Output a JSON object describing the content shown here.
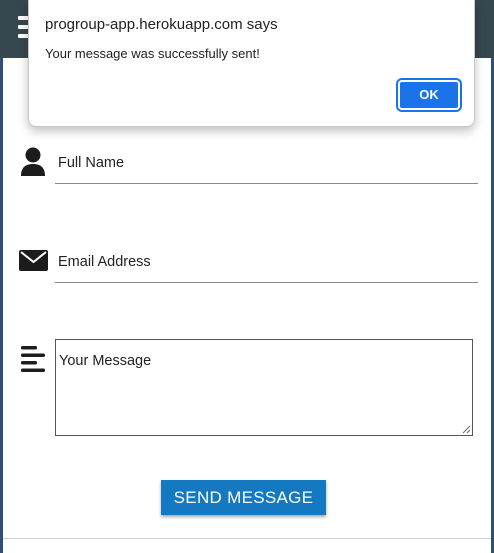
{
  "dialog": {
    "title": "progroup-app.herokuapp.com says",
    "message": "Your message was successfully sent!",
    "ok_label": "OK"
  },
  "form": {
    "full_name_placeholder": "Full Name",
    "email_placeholder": "Email Address",
    "message_placeholder": "Your Message",
    "send_label": "SEND MESSAGE"
  },
  "colors": {
    "topbar": "#37474f",
    "send_button": "#1479c1",
    "ok_button": "#1a73e8"
  },
  "icons": {
    "menu": "hamburger-icon",
    "name": "person-icon",
    "email": "envelope-icon",
    "message": "text-align-left-icon"
  }
}
